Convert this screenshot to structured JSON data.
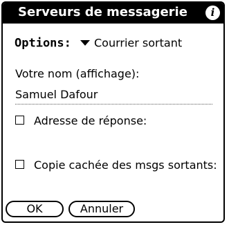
{
  "dialog": {
    "title": "Serveurs de messagerie",
    "info_icon": "ⓘ"
  },
  "options": {
    "label": "Options:",
    "selected": "Courrier sortant",
    "icon": "dropdown-triangle"
  },
  "name_field": {
    "label": "Votre nom (affichage):",
    "value": "Samuel Dafour"
  },
  "checkboxes": [
    {
      "label": "Adresse de réponse:",
      "checked": false
    },
    {
      "label": "Copie cachée des msgs sortants:",
      "checked": false
    }
  ],
  "buttons": {
    "ok": "OK",
    "cancel": "Annuler"
  }
}
